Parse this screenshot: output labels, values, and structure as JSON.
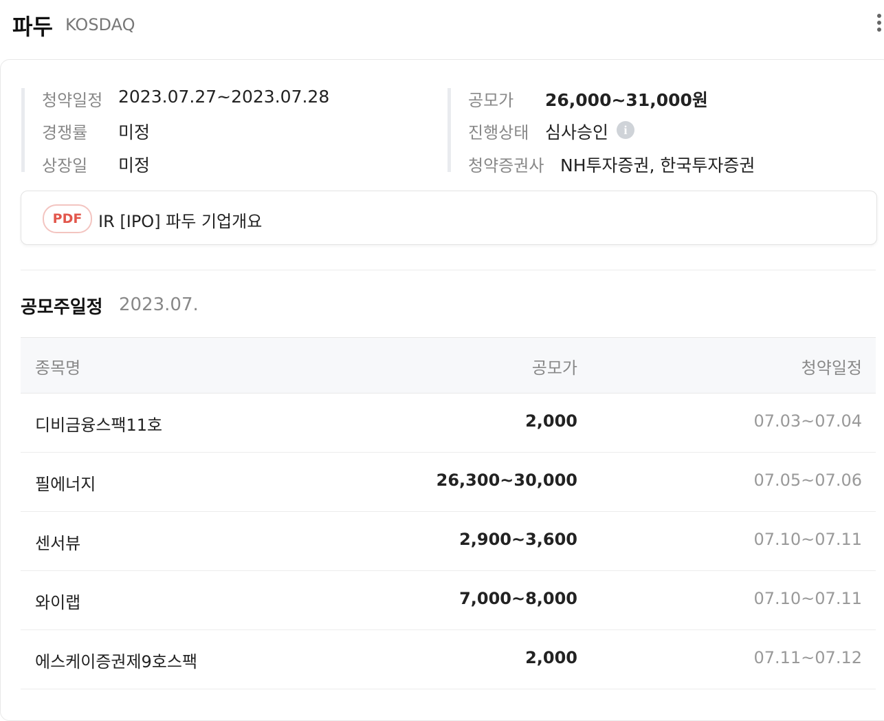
{
  "header": {
    "stock_name": "파두",
    "market": "KOSDAQ"
  },
  "info": {
    "left": [
      {
        "label": "청약일정",
        "value": "2023.07.27~2023.07.28"
      },
      {
        "label": "경쟁률",
        "value": "미정"
      },
      {
        "label": "상장일",
        "value": "미정"
      }
    ],
    "right": [
      {
        "label": "공모가",
        "value": "26,000~31,000원"
      },
      {
        "label": "진행상태",
        "value": "심사승인",
        "icon": "info-icon",
        "icon_glyph": "i"
      },
      {
        "label": "청약증권사",
        "value": "NH투자증권, 한국투자증권"
      }
    ]
  },
  "document": {
    "badge": "PDF",
    "title": "IR [IPO] 파두 기업개요"
  },
  "schedule": {
    "title": "공모주일정",
    "month": "2023.07.",
    "columns": [
      "종목명",
      "공모가",
      "청약일정"
    ],
    "rows": [
      {
        "name": "디비금융스팩11호",
        "price": "2,000",
        "date": "07.03~07.04"
      },
      {
        "name": "필에너지",
        "price": "26,300~30,000",
        "date": "07.05~07.06"
      },
      {
        "name": "센서뷰",
        "price": "2,900~3,600",
        "date": "07.10~07.11"
      },
      {
        "name": "와이랩",
        "price": "7,000~8,000",
        "date": "07.10~07.11"
      },
      {
        "name": "에스케이증권제9호스팩",
        "price": "2,000",
        "date": "07.11~07.12"
      }
    ]
  },
  "colors": {
    "pdf_accent": "#e2574c",
    "muted_text": "#888888",
    "table_header_bg": "#f7f8fa"
  }
}
